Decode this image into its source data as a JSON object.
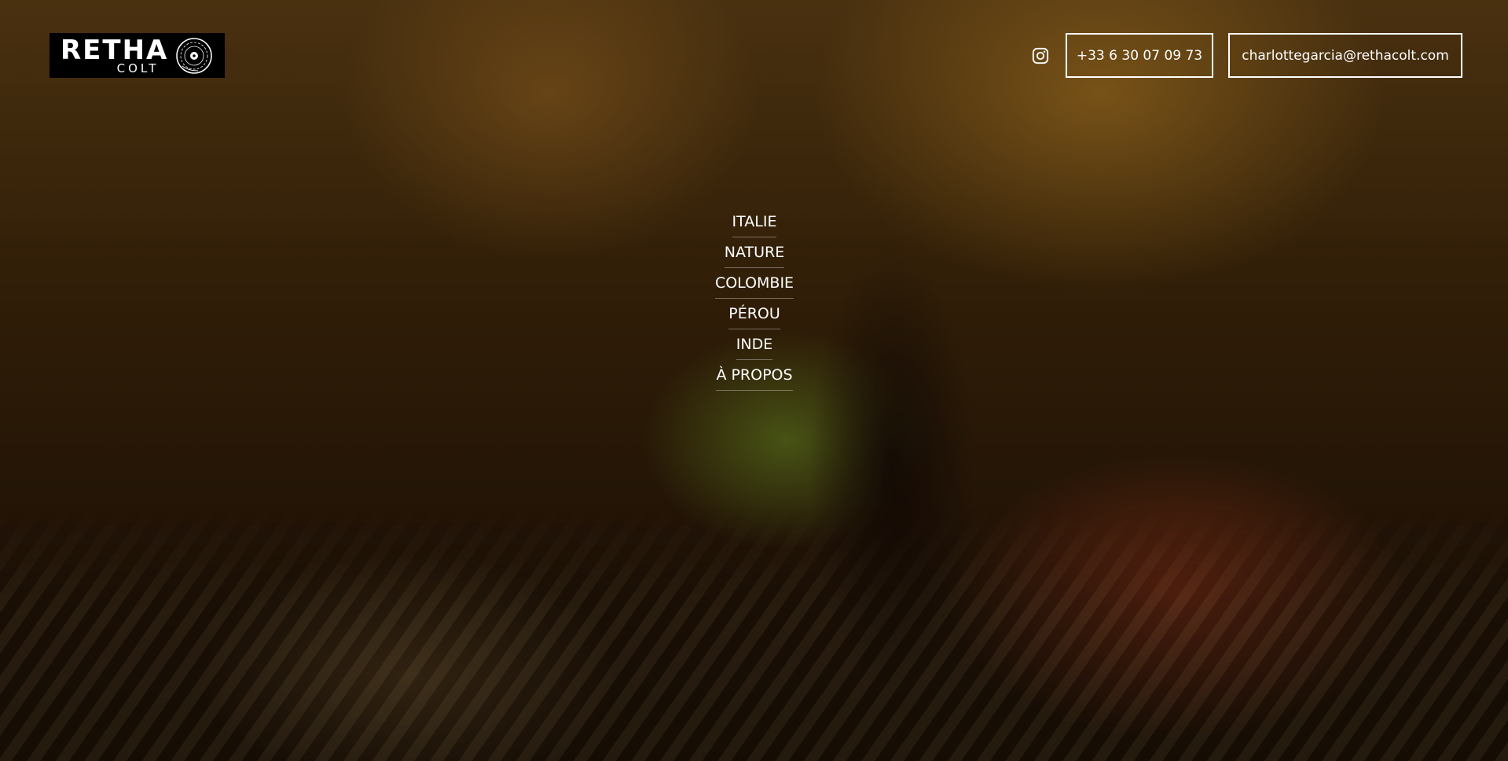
{
  "logo": {
    "name": "RETHA",
    "sub": "COLT",
    "icon": "vinyl-record-icon"
  },
  "header": {
    "instagram_icon": "instagram-icon",
    "phone": "+33 6 30 07 09 73",
    "email": "charlottegarcia@rethacolt.com"
  },
  "nav": {
    "items": [
      {
        "label": "ITALIE"
      },
      {
        "label": "NATURE"
      },
      {
        "label": "COLOMBIE"
      },
      {
        "label": "PÉROU"
      },
      {
        "label": "INDE"
      },
      {
        "label": "À PROPOS"
      }
    ]
  },
  "colors": {
    "text": "#ffffff",
    "logo_bg": "#000000",
    "photo_tone": "#5a3c14"
  }
}
